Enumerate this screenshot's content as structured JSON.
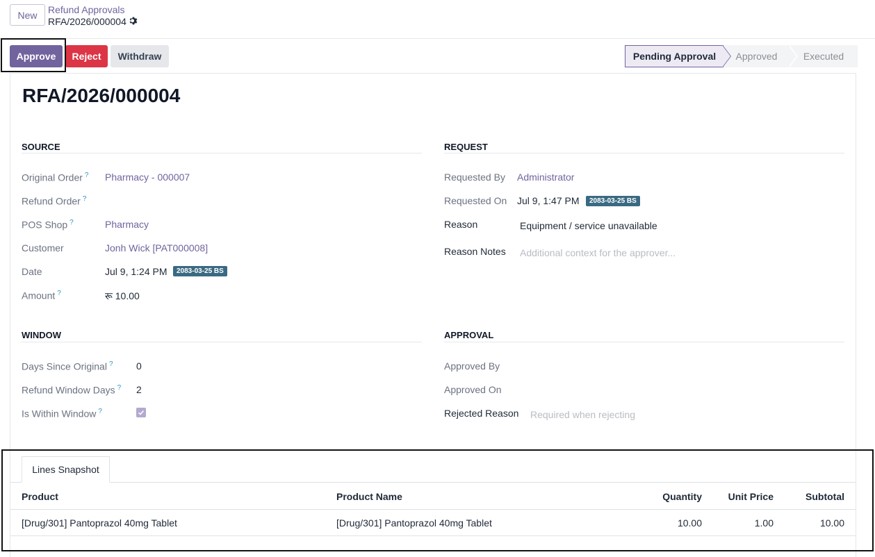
{
  "control_panel": {
    "new_label": "New",
    "breadcrumb_parent": "Refund Approvals",
    "breadcrumb_current": "RFA/2026/000004"
  },
  "actions": {
    "approve": "Approve",
    "reject": "Reject",
    "withdraw": "Withdraw"
  },
  "status_bar": {
    "stages": [
      "Pending Approval",
      "Approved",
      "Executed"
    ],
    "active": "Pending Approval"
  },
  "record": {
    "title": "RFA/2026/000004"
  },
  "source": {
    "section_title": "SOURCE",
    "original_order_label": "Original Order",
    "original_order_value": "Pharmacy - 000007",
    "refund_order_label": "Refund Order",
    "pos_shop_label": "POS Shop",
    "pos_shop_value": "Pharmacy",
    "customer_label": "Customer",
    "customer_value": "Jonh Wick [PAT000008]",
    "date_label": "Date",
    "date_value": "Jul 9, 1:24 PM",
    "date_badge": "2083-03-25 BS",
    "amount_label": "Amount",
    "amount_value": "रू 10.00"
  },
  "request": {
    "section_title": "REQUEST",
    "requested_by_label": "Requested By",
    "requested_by_value": "Administrator",
    "requested_on_label": "Requested On",
    "requested_on_value": "Jul 9, 1:47 PM",
    "requested_on_badge": "2083-03-25 BS",
    "reason_label": "Reason",
    "reason_value": "Equipment / service unavailable",
    "reason_notes_label": "Reason Notes",
    "reason_notes_placeholder": "Additional context for the approver..."
  },
  "window": {
    "section_title": "WINDOW",
    "days_since_label": "Days Since Original",
    "days_since_value": "0",
    "window_days_label": "Refund Window Days",
    "window_days_value": "2",
    "within_label": "Is Within Window",
    "within_checked": true
  },
  "approval": {
    "section_title": "APPROVAL",
    "approved_by_label": "Approved By",
    "approved_on_label": "Approved On",
    "rejected_reason_label": "Rejected Reason",
    "rejected_reason_placeholder": "Required when rejecting"
  },
  "lines": {
    "tab_label": "Lines Snapshot",
    "columns": [
      "Product",
      "Product Name",
      "Quantity",
      "Unit Price",
      "Subtotal"
    ],
    "rows": [
      {
        "product": "[Drug/301] Pantoprazol 40mg Tablet",
        "product_name": "[Drug/301] Pantoprazol 40mg Tablet",
        "quantity": "10.00",
        "unit_price": "1.00",
        "subtotal": "10.00"
      }
    ]
  },
  "colors": {
    "primary": "#71639e",
    "danger": "#dc3545",
    "badge": "#3a6a82",
    "help": "#2b96c3"
  }
}
